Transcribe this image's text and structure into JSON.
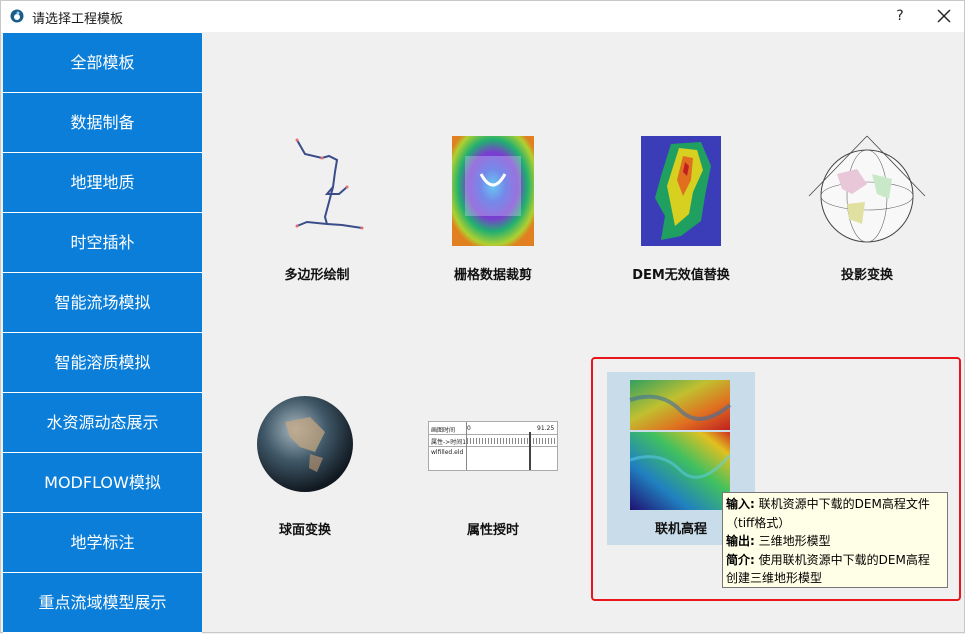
{
  "window": {
    "title": "请选择工程模板",
    "help_label": "?"
  },
  "sidebar": {
    "items": [
      {
        "label": "全部模板"
      },
      {
        "label": "数据制备"
      },
      {
        "label": "地理地质"
      },
      {
        "label": "时空插补"
      },
      {
        "label": "智能流场模拟"
      },
      {
        "label": "智能溶质模拟"
      },
      {
        "label": "水资源动态展示"
      },
      {
        "label": "MODFLOW模拟"
      },
      {
        "label": "地学标注"
      },
      {
        "label": "重点流域模型展示"
      }
    ]
  },
  "templates": [
    {
      "label": "多边形绘制"
    },
    {
      "label": "栅格数据裁剪"
    },
    {
      "label": "DEM无效值替换"
    },
    {
      "label": "投影变换"
    },
    {
      "label": "球面变换"
    },
    {
      "label": "属性授时",
      "thumb_text": {
        "row1": "画图时间",
        "row1_val": "0",
        "row1_end": "91.25",
        "row2": "属性->时间1",
        "row3": "wlfilled.eld"
      }
    },
    {
      "label": "联机高程"
    }
  ],
  "tooltip": {
    "input_label": "输入:",
    "input_text": "联机资源中下载的DEM高程文件",
    "input_text2": "（tiff格式）",
    "output_label": "输出:",
    "output_text": "三维地形模型",
    "intro_label": "简介:",
    "intro_text": "使用联机资源中下载的DEM高程",
    "intro_text2": "创建三维地形模型"
  },
  "colors": {
    "sidebar_bg": "#0a7ed8",
    "highlight": "#e8161a",
    "selected_bg": "#c9dcea",
    "tooltip_bg": "#fffee6"
  }
}
